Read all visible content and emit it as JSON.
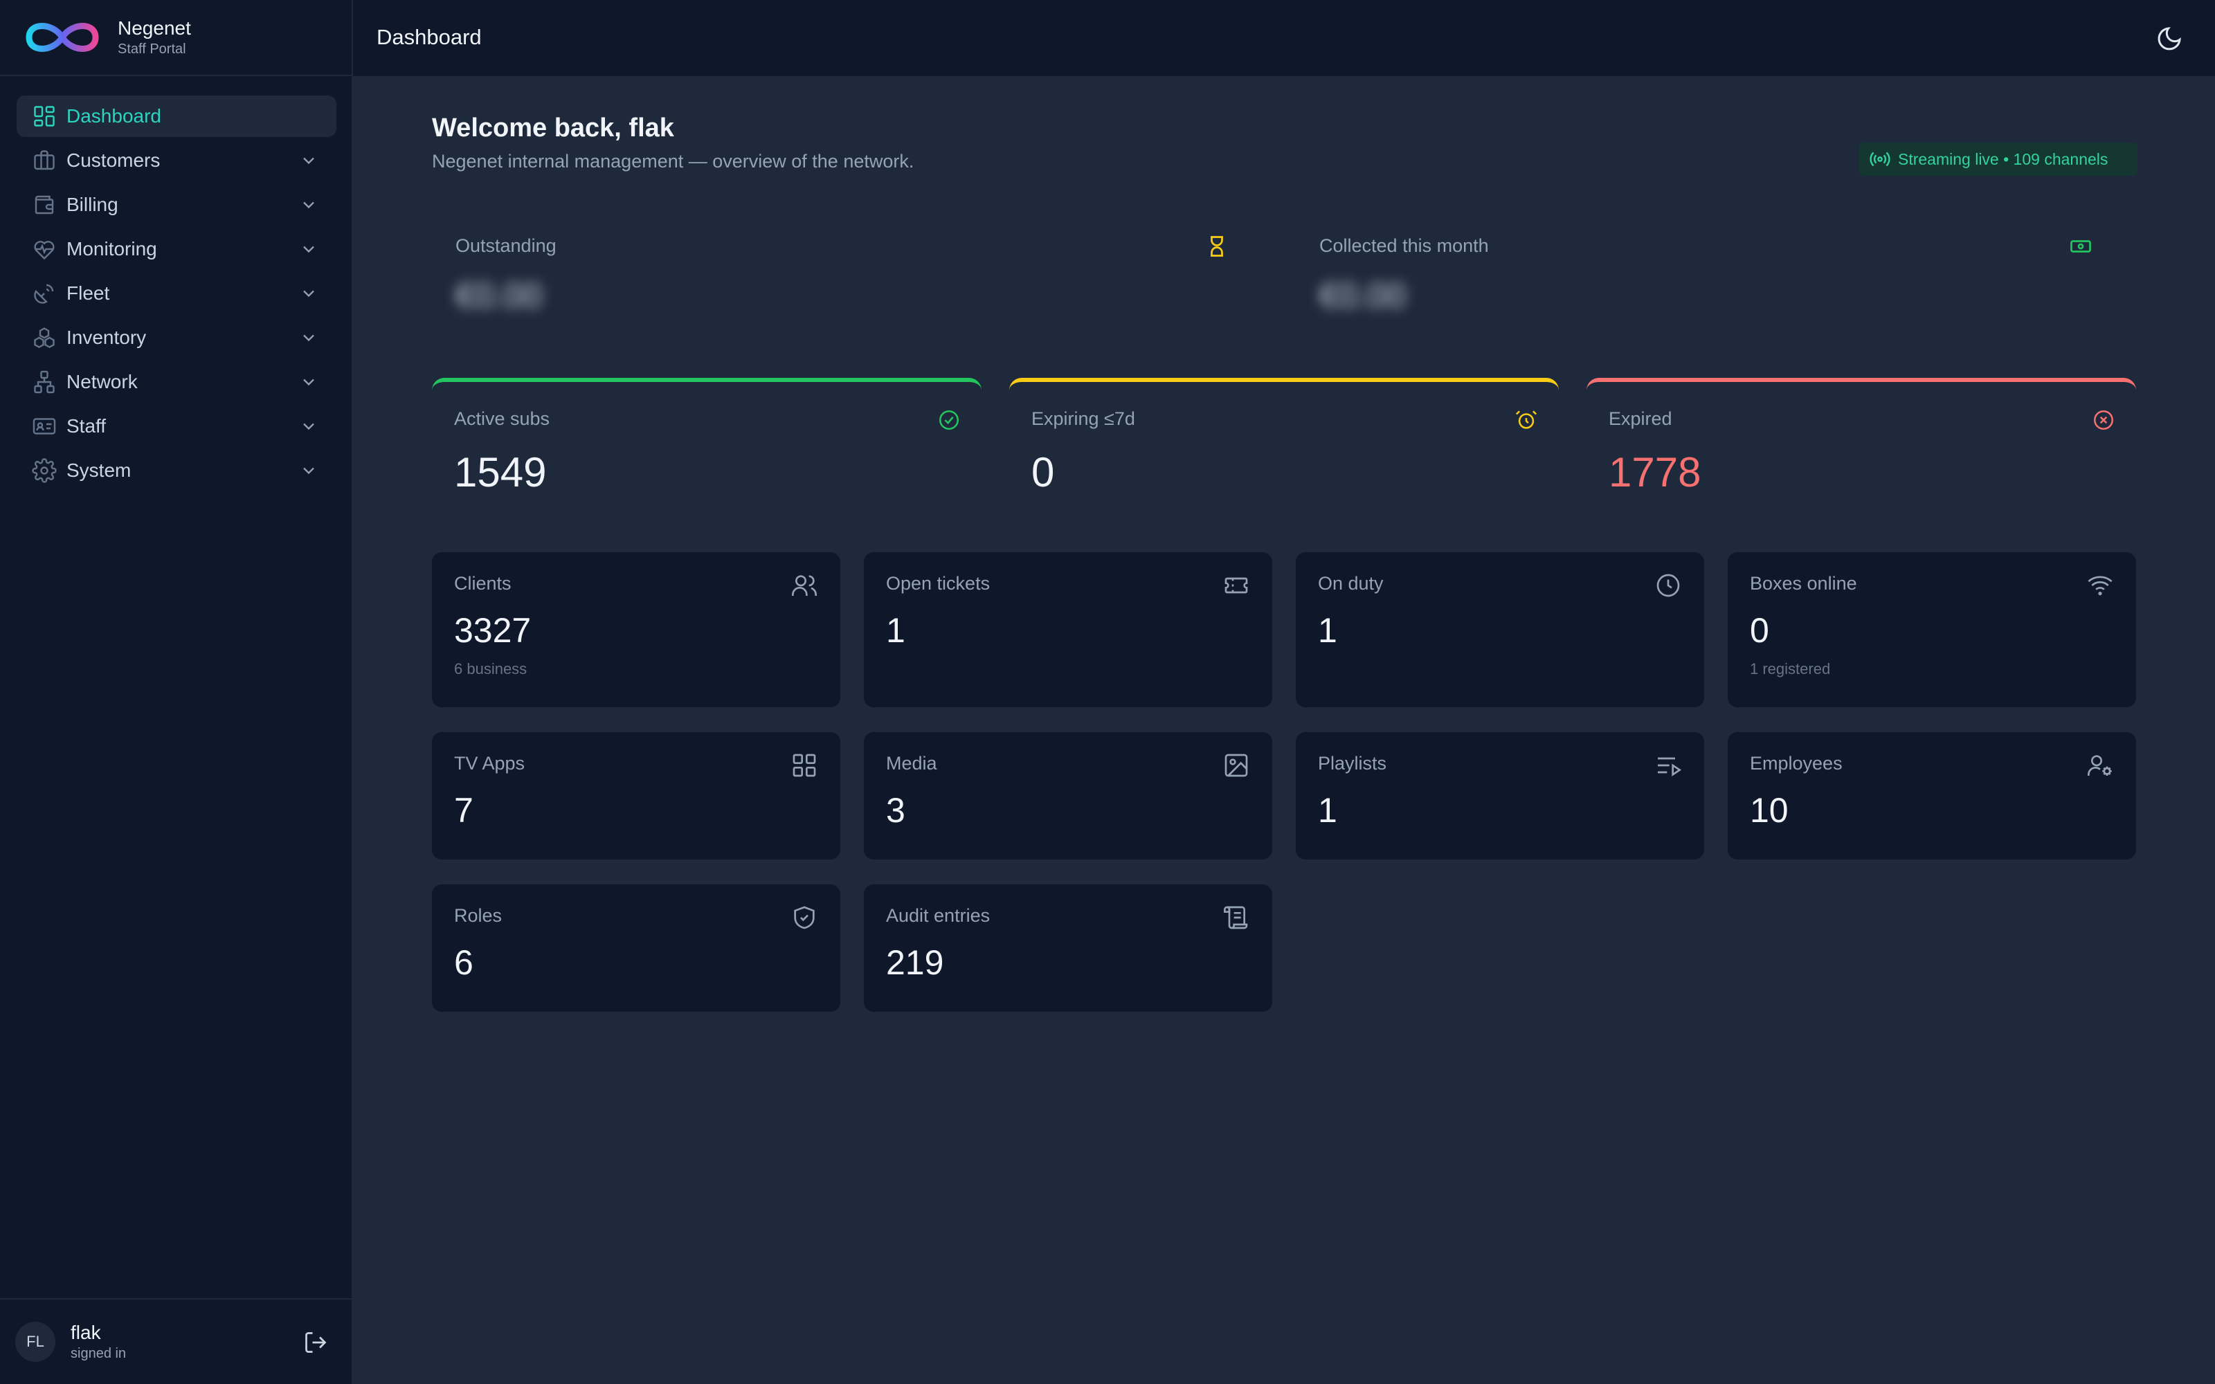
{
  "brand": {
    "name": "Negenet",
    "subtitle": "Staff Portal",
    "logo": "infinity-logo"
  },
  "sidebar": {
    "items": [
      {
        "label": "Dashboard",
        "icon": "dashboard-icon",
        "active": true
      },
      {
        "label": "Customers",
        "icon": "briefcase-icon"
      },
      {
        "label": "Billing",
        "icon": "wallet-icon"
      },
      {
        "label": "Monitoring",
        "icon": "heart-pulse-icon"
      },
      {
        "label": "Fleet",
        "icon": "satellite-dish-icon"
      },
      {
        "label": "Inventory",
        "icon": "boxes-icon"
      },
      {
        "label": "Network",
        "icon": "network-icon"
      },
      {
        "label": "Staff",
        "icon": "id-card-icon"
      },
      {
        "label": "System",
        "icon": "gear-icon"
      }
    ]
  },
  "user": {
    "initials": "FL",
    "name": "flak",
    "status": "signed in"
  },
  "header": {
    "title": "Dashboard"
  },
  "welcome": {
    "title": "Welcome back, flak",
    "subtitle": "Negenet internal management — overview of the network."
  },
  "live_badge": {
    "text": "Streaming live • 109 channels"
  },
  "money": {
    "outstanding": {
      "label": "Outstanding",
      "value": "€0.00"
    },
    "collected": {
      "label": "Collected this month",
      "value": "€0.00"
    }
  },
  "status": {
    "active": {
      "label": "Active subs",
      "value": "1549"
    },
    "expiring": {
      "label": "Expiring ≤7d",
      "value": "0"
    },
    "expired": {
      "label": "Expired",
      "value": "1778"
    }
  },
  "stats": {
    "clients": {
      "label": "Clients",
      "value": "3327",
      "sub": "6 business"
    },
    "tickets": {
      "label": "Open tickets",
      "value": "1"
    },
    "on_duty": {
      "label": "On duty",
      "value": "1"
    },
    "boxes": {
      "label": "Boxes online",
      "value": "0",
      "sub": "1 registered"
    },
    "tv_apps": {
      "label": "TV Apps",
      "value": "7"
    },
    "media": {
      "label": "Media",
      "value": "3"
    },
    "playlists": {
      "label": "Playlists",
      "value": "1"
    },
    "employees": {
      "label": "Employees",
      "value": "10"
    },
    "roles": {
      "label": "Roles",
      "value": "6"
    },
    "audit": {
      "label": "Audit entries",
      "value": "219"
    }
  },
  "colors": {
    "accent": "#2dd4bf",
    "success": "#22c55e",
    "warning": "#facc15",
    "danger": "#f87171",
    "background": "#1e293b",
    "surface": "#0f172a"
  }
}
